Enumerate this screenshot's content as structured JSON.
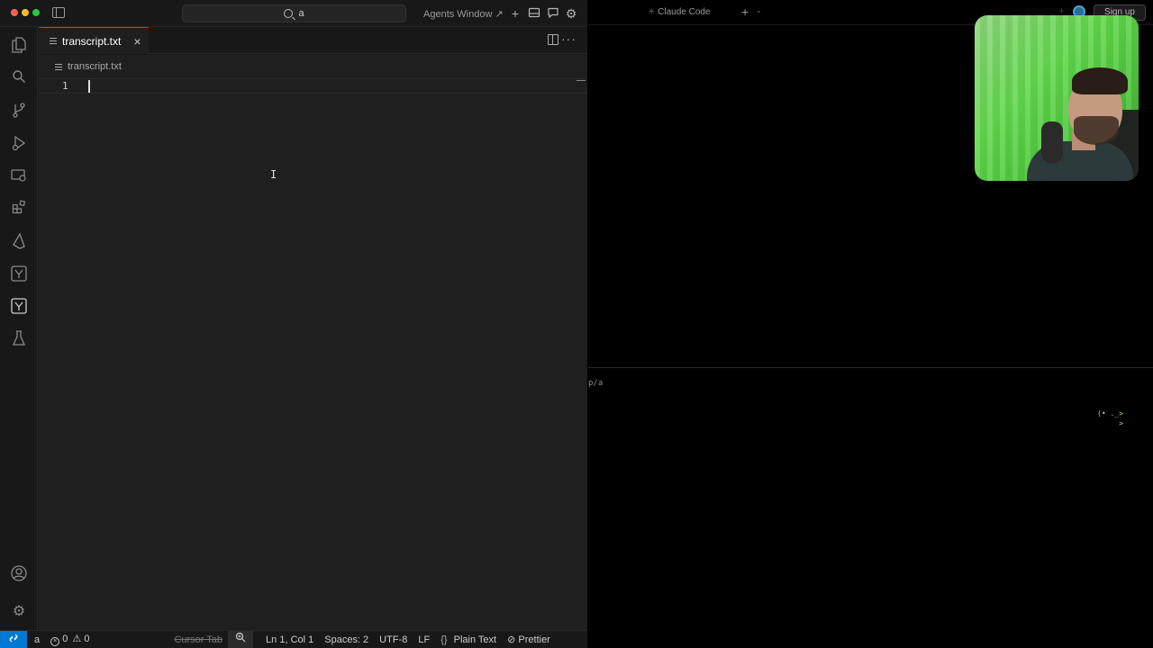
{
  "titlebar": {
    "search_text": "a",
    "agents_window_label": "Agents Window",
    "agents_window_arrow": "↗"
  },
  "tabs": [
    {
      "label": "transcript.txt",
      "close": "×"
    }
  ],
  "breadcrumb": {
    "file": "transcript.txt"
  },
  "editor": {
    "line_numbers": [
      "1"
    ]
  },
  "statusbar": {
    "workspace": "a",
    "errors": "0",
    "warnings": "0",
    "cursor_tab": "Cursor Tab",
    "position": "Ln 1, Col 1",
    "indentation": "Spaces: 2",
    "encoding": "UTF-8",
    "eol": "LF",
    "language_brace": "{}",
    "language": "Plain Text",
    "formatter": "Prettier"
  },
  "terminal": {
    "tab_title": "Claude Code",
    "signup_label": "Sign up",
    "path_text": "p/a",
    "ascii_art": "(• ._>\n     >"
  },
  "colors": {
    "accent": "#0078d4",
    "editor_bg": "#1f1f1f",
    "chrome_bg": "#181818",
    "terminal_bg": "#000000"
  }
}
